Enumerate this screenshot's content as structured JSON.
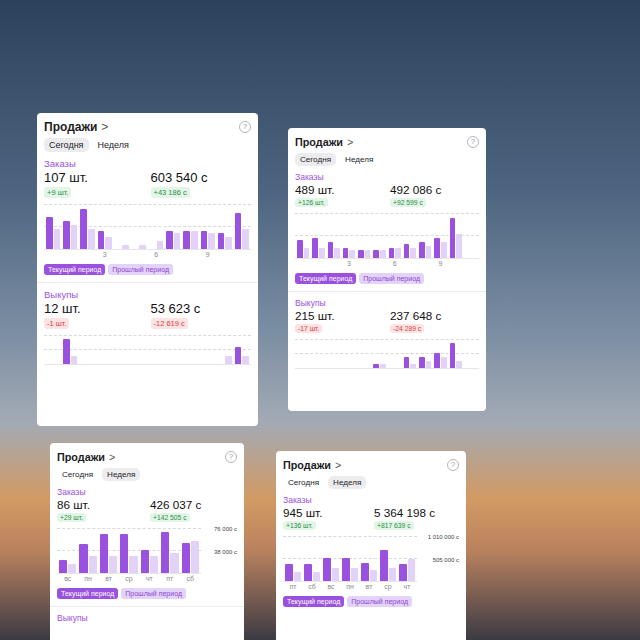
{
  "cards": [
    {
      "title": "Продажи",
      "chevron": ">",
      "help": "?",
      "tabs": [
        {
          "label": "Сегодня",
          "selected": true
        },
        {
          "label": "Неделя",
          "selected": false
        }
      ],
      "orders": {
        "label": "Заказы",
        "count": "107 шт.",
        "count_delta": "+9 шт.",
        "sum": "603 540 с",
        "sum_delta": "+43 186 с",
        "trend": "up",
        "chart": {
          "current": [
            16,
            14,
            20,
            9,
            0,
            0,
            0,
            9,
            9,
            9,
            8,
            18
          ],
          "previous": [
            10,
            12,
            10,
            6,
            2,
            2,
            4,
            8,
            9,
            8,
            6,
            10
          ],
          "x_ticks": [
            "3",
            "6",
            "9"
          ],
          "y_ticks": []
        }
      },
      "legend": [
        {
          "label": "Текущий период",
          "series": "current"
        },
        {
          "label": "Прошлый период",
          "series": "previous"
        }
      ],
      "buyouts": {
        "label": "Выкупы",
        "count": "12 шт.",
        "count_delta": "-1 шт.",
        "sum": "53 623 с",
        "sum_delta": "-12 619 с",
        "trend": "down",
        "chart": {
          "current": [
            0,
            3,
            0,
            0,
            0,
            0,
            0,
            0,
            0,
            0,
            0,
            2
          ],
          "previous": [
            0,
            1,
            0,
            0,
            0,
            0,
            0,
            0,
            0,
            0,
            1,
            1
          ],
          "x_ticks": [],
          "y_ticks": []
        }
      }
    },
    {
      "title": "Продажи",
      "chevron": ">",
      "help": "?",
      "tabs": [
        {
          "label": "Сегодня",
          "selected": true
        },
        {
          "label": "Неделя",
          "selected": false
        }
      ],
      "orders": {
        "label": "Заказы",
        "count": "489 шт.",
        "count_delta": "+126 шт.",
        "sum": "492 086 с",
        "sum_delta": "+92 599 с",
        "trend": "up",
        "chart": {
          "current": [
            9,
            10,
            8,
            5,
            4,
            4,
            5,
            7,
            8,
            10,
            20,
            0
          ],
          "previous": [
            5,
            5,
            5,
            4,
            4,
            4,
            5,
            5,
            6,
            8,
            12,
            0
          ],
          "x_ticks": [
            "3",
            "6",
            "9"
          ],
          "y_ticks": []
        }
      },
      "legend": [
        {
          "label": "Текущий период",
          "series": "current"
        },
        {
          "label": "Прошлый период",
          "series": "previous"
        }
      ],
      "buyouts": {
        "label": "Выкупы",
        "count": "215 шт.",
        "count_delta": "-17 шт.",
        "sum": "237 648 с",
        "sum_delta": "-24 289 с",
        "trend": "down",
        "chart": {
          "current": [
            0,
            0,
            0,
            0,
            0,
            1,
            0,
            3,
            3,
            4,
            7,
            0
          ],
          "previous": [
            0,
            0,
            0,
            0,
            0,
            1,
            0,
            1,
            2,
            3,
            2,
            0
          ],
          "x_ticks": [],
          "y_ticks": []
        }
      }
    },
    {
      "title": "Продажи",
      "chevron": ">",
      "help": "?",
      "tabs": [
        {
          "label": "Сегодня",
          "selected": false
        },
        {
          "label": "Неделя",
          "selected": true
        }
      ],
      "orders": {
        "label": "Заказы",
        "count": "86 шт.",
        "count_delta": "+29 шт.",
        "sum": "426 037 с",
        "sum_delta": "+142 505 с",
        "trend": "up",
        "chart": {
          "current": [
            22000,
            50000,
            68000,
            68000,
            40000,
            70000,
            52000
          ],
          "previous": [
            15000,
            30000,
            30000,
            30000,
            30000,
            35000,
            55000
          ],
          "x_ticks": [
            "вс",
            "пн",
            "вт",
            "ср",
            "чт",
            "пт",
            "сб"
          ],
          "y_ticks": [
            "76 000 с",
            "38 000 с"
          ]
        }
      },
      "legend": [
        {
          "label": "Текущий период",
          "series": "current"
        },
        {
          "label": "Прошлый период",
          "series": "previous"
        }
      ],
      "buyouts": {
        "label": "Выкупы"
      }
    },
    {
      "title": "Продажи",
      "chevron": ">",
      "help": "?",
      "tabs": [
        {
          "label": "Сегодня",
          "selected": false
        },
        {
          "label": "Неделя",
          "selected": true
        }
      ],
      "orders": {
        "label": "Заказы",
        "count": "945 шт.",
        "count_delta": "+136 шт.",
        "sum": "5 364 198 с",
        "sum_delta": "+817 639 с",
        "trend": "up",
        "chart": {
          "current": [
            380000,
            380000,
            520000,
            520000,
            420000,
            720000,
            380000
          ],
          "previous": [
            200000,
            200000,
            300000,
            300000,
            250000,
            300000,
            500000
          ],
          "x_ticks": [
            "пт",
            "сб",
            "вс",
            "пн",
            "вт",
            "ср",
            "чт"
          ],
          "y_ticks": [
            "1 010 000 с",
            "505 000 с"
          ]
        }
      },
      "legend": [
        {
          "label": "Текущий период",
          "series": "current"
        },
        {
          "label": "Прошлый период",
          "series": "previous"
        }
      ]
    }
  ]
}
